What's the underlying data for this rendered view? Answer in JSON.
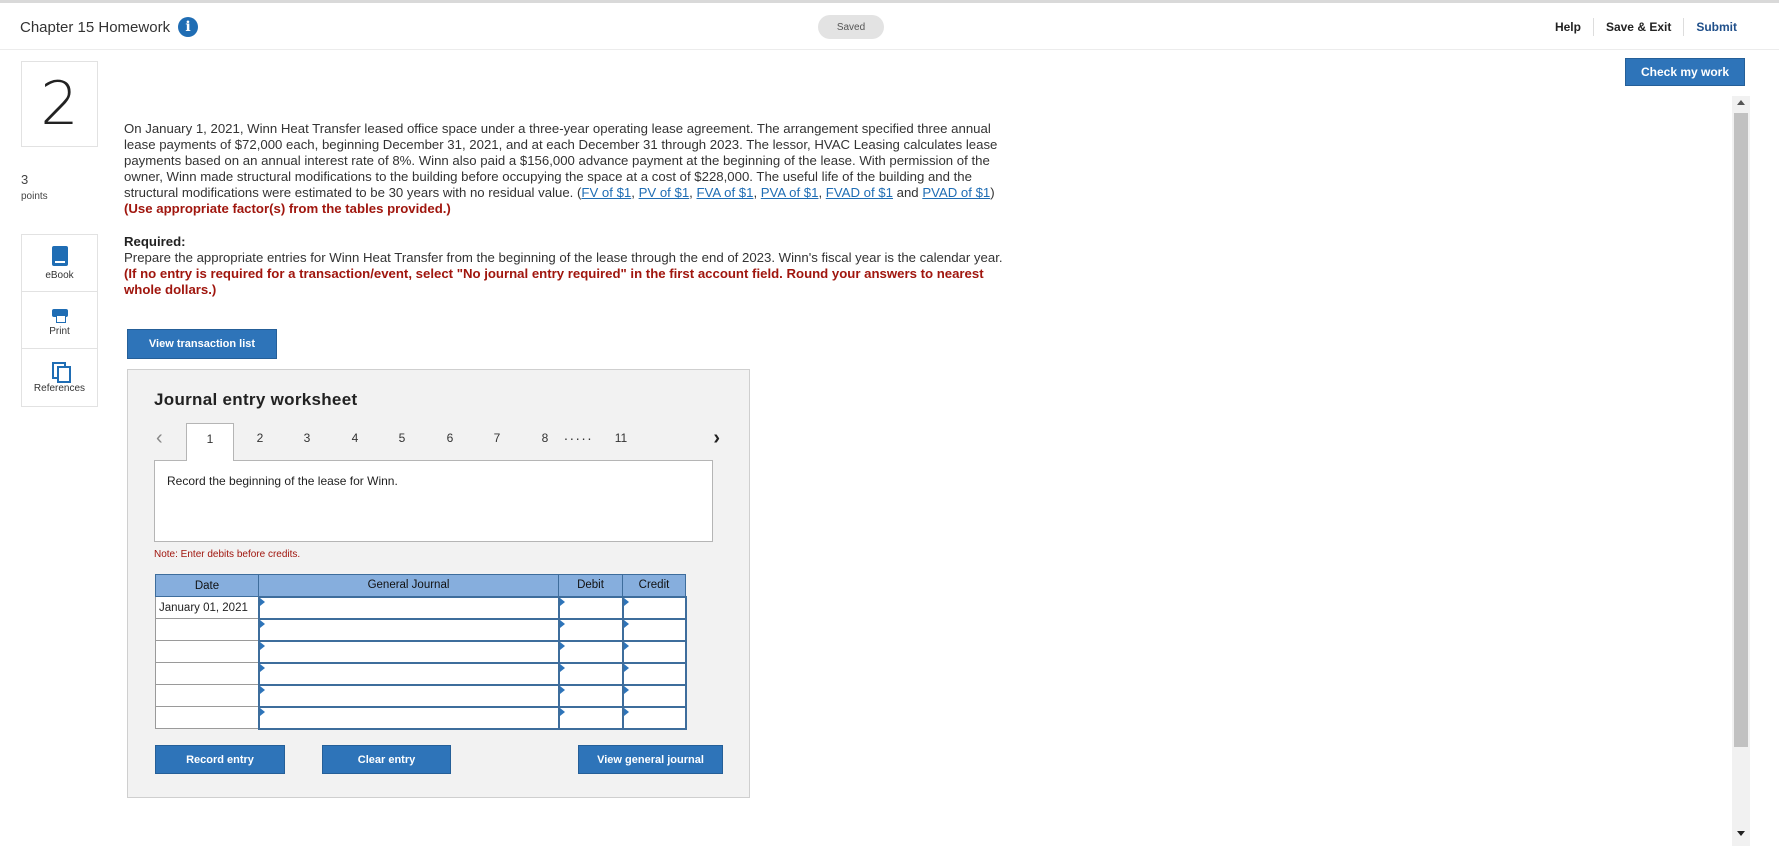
{
  "header": {
    "title": "Chapter 15 Homework",
    "saved": "Saved",
    "help": "Help",
    "save_exit": "Save & Exit",
    "submit": "Submit",
    "check_my_work": "Check my work"
  },
  "question": {
    "number": "2",
    "points_value": "3",
    "points_label": "points"
  },
  "tools": [
    {
      "label": "eBook",
      "icon": "ebook-icon"
    },
    {
      "label": "Print",
      "icon": "print-icon"
    },
    {
      "label": "References",
      "icon": "references-icon"
    }
  ],
  "problem": {
    "text": "On January 1, 2021, Winn Heat Transfer leased office space under a three-year operating lease agreement. The arrangement specified three annual lease payments of $72,000 each, beginning December 31, 2021, and at each December 31 through 2023. The lessor, HVAC Leasing calculates lease payments based on an annual interest rate of 8%. Winn also paid a $156,000 advance payment at the beginning of the lease. With permission of the owner, Winn made structural modifications to the building before occupying the space at a cost of $228,000. The useful life of the building and the structural modifications were estimated to be 30 years with no residual value. (",
    "links": [
      "FV of $1",
      "PV of $1",
      "FVA of $1",
      "PVA of $1",
      "FVAD of $1",
      "PVAD of $1"
    ],
    "and_text": " and ",
    "close_paren": ") ",
    "instruction": "(Use appropriate factor(s) from the tables provided.)"
  },
  "required": {
    "heading": "Required:",
    "text": "Prepare the appropriate entries for Winn Heat Transfer from the beginning of the lease through the end of 2023. Winn's fiscal year is the calendar year. ",
    "instruction": "(If no entry is required for a transaction/event, select \"No journal entry required\" in the first account field. Round your answers to nearest whole dollars.)"
  },
  "view_transaction_list": "View transaction list",
  "worksheet": {
    "title": "Journal entry worksheet",
    "tabs": [
      "1",
      "2",
      "3",
      "4",
      "5",
      "6",
      "7",
      "8",
      "11"
    ],
    "dots": ".....",
    "active_tab": "1",
    "record_text": "Record the beginning of the lease for Winn.",
    "note": "Note: Enter debits before credits.",
    "columns": [
      "Date",
      "General Journal",
      "Debit",
      "Credit"
    ],
    "rows": [
      {
        "date": "January 01, 2021"
      },
      {
        "date": ""
      },
      {
        "date": ""
      },
      {
        "date": ""
      },
      {
        "date": ""
      },
      {
        "date": ""
      }
    ],
    "buttons": {
      "record": "Record entry",
      "clear": "Clear entry",
      "view_journal": "View general journal"
    }
  }
}
